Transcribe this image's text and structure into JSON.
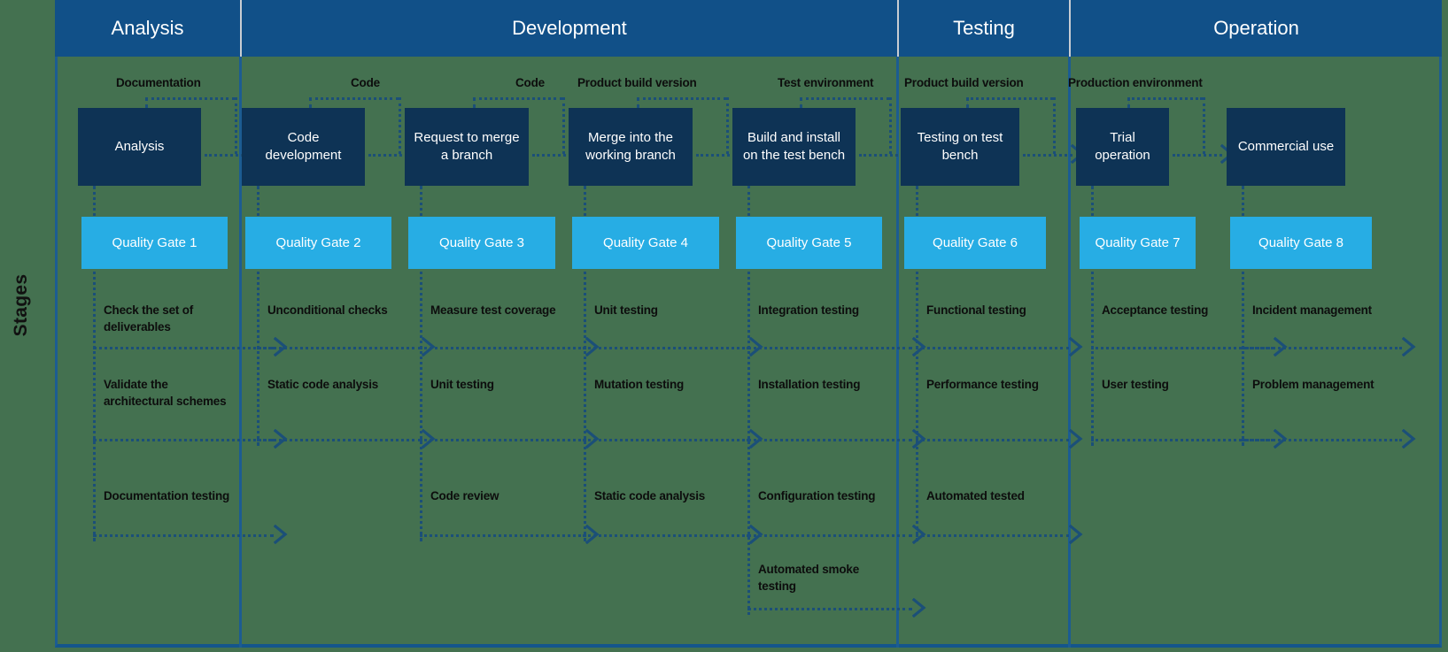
{
  "axis": {
    "label": "Stages"
  },
  "colors": {
    "background": "#447150",
    "header_blue": "#115088",
    "process_navy": "#0e3355",
    "gate_cyan": "#27ADE4",
    "connector_blue": "#1b4f78",
    "frame_blue": "#1c5c92",
    "text_dark": "#0d0d0d",
    "text_light": "#ffffff"
  },
  "stages": [
    {
      "name": "Analysis"
    },
    {
      "name": "Development"
    },
    {
      "name": "Testing"
    },
    {
      "name": "Operation"
    }
  ],
  "lanes": [
    {
      "stage": "Analysis",
      "artefact": "Documentation",
      "process": "Analysis",
      "gate": "Quality Gate 1",
      "activities": [
        "Check the set of deliverables",
        "Validate the architectural schemes",
        "Documentation testing"
      ]
    },
    {
      "stage": "Development",
      "artefact": "Code",
      "process": "Code development",
      "gate": "Quality Gate 2",
      "activities": [
        "Unconditional checks",
        "Static code analysis"
      ]
    },
    {
      "stage": "Development",
      "artefact": "Code",
      "process": "Request to merge a branch",
      "gate": "Quality Gate 3",
      "activities": [
        "Measure test coverage",
        "Unit testing",
        "Code review"
      ]
    },
    {
      "stage": "Development",
      "artefact": "Product build version",
      "process": "Merge into the working branch",
      "gate": "Quality Gate 4",
      "activities": [
        "Unit testing",
        "Mutation testing",
        "Static code analysis"
      ]
    },
    {
      "stage": "Development",
      "artefact": "Test environment",
      "process": "Build and install on the test bench",
      "gate": "Quality Gate 5",
      "activities": [
        "Integration testing",
        "Installation testing",
        "Configuration testing",
        "Automated smoke testing"
      ]
    },
    {
      "stage": "Testing",
      "artefact": "Product build version",
      "process": "Testing on test bench",
      "gate": "Quality Gate 6",
      "activities": [
        "Functional testing",
        "Performance testing",
        "Automated tested"
      ]
    },
    {
      "stage": "Operation",
      "artefact": "Production environment",
      "process": "Trial operation",
      "gate": "Quality Gate 7",
      "activities": [
        "Acceptance testing",
        "User testing"
      ]
    },
    {
      "stage": "Operation",
      "artefact": "",
      "process": "Commercial use",
      "gate": "Quality Gate 8",
      "activities": [
        "Incident management",
        "Problem management"
      ]
    }
  ]
}
